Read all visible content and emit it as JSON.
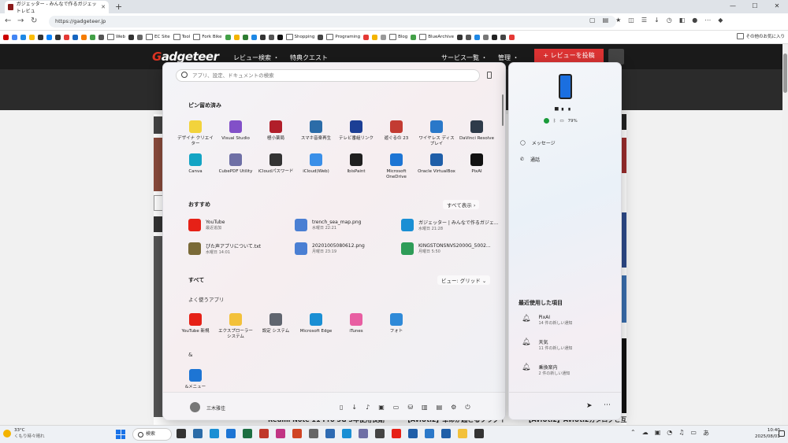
{
  "browser": {
    "tab_title": "ガジェッター - みんなで作るガジェットレビュ",
    "url": "https://gadgeteer.jp",
    "bookmarks": [
      "Web",
      "EC Site",
      "Tool",
      "Fork Bike",
      "Shopping",
      "Programing",
      "Blog",
      "BlueArchive"
    ],
    "other_bookmarks": "その他のお気に入り"
  },
  "site": {
    "logo_a": "G",
    "logo_b": "adgeteer",
    "nav": [
      "レビュー検索 ・",
      "特典クエスト",
      "サービス一覧 ・",
      "管理 ・"
    ],
    "post_button": "+ レビューを投稿",
    "headlines": [
      "Redmi Note 11 Pro 5G 3年使用長期",
      "【AviUtl2】革命が起こるプラグイ",
      "【AviUtl2】AviUtl2カタログと互"
    ]
  },
  "start_menu": {
    "search_placeholder": "アプリ、設定、ドキュメントの検索",
    "pinned_title": "ピン留め済み",
    "pinned": [
      {
        "label": "デザイナ クリエイター",
        "color": "#f2d33c"
      },
      {
        "label": "Visual Studio",
        "color": "#8250c8"
      },
      {
        "label": "極小薬局",
        "color": "#b11e2a"
      },
      {
        "label": "スマホ音楽再生",
        "color": "#2b6ca8"
      },
      {
        "label": "テレビ番組リンク",
        "color": "#1c3f95"
      },
      {
        "label": "遊ぐるの 23",
        "color": "#c33b32"
      },
      {
        "label": "ワイヤレス ディスプレイ",
        "color": "#2a78c9"
      },
      {
        "label": "DaVinci Resolve",
        "color": "#2e3b4a"
      },
      {
        "label": "Canva",
        "color": "#13a4c4"
      },
      {
        "label": "CubePDF Utility",
        "color": "#6e6fa5"
      },
      {
        "label": "iCloudパスワード",
        "color": "#333333"
      },
      {
        "label": "iCloud(Web)",
        "color": "#3a8fe8"
      },
      {
        "label": "IbisPaint",
        "color": "#1f1f1f"
      },
      {
        "label": "Microsoft OneDrive",
        "color": "#1d75d4"
      },
      {
        "label": "Oracle VirtualBox",
        "color": "#1f5ea8"
      },
      {
        "label": "PixAI",
        "color": "#111111"
      }
    ],
    "recommended_title": "おすすめ",
    "recommended_button": "すべて表示  ›",
    "recommended": [
      {
        "title": "YouTube",
        "sub": "最近追加",
        "color": "#e62117"
      },
      {
        "title": "trench_sea_map.png",
        "sub": "水曜日 22:21",
        "color": "#4a7fd3"
      },
      {
        "title": "ガジェッター | みんなで作るガジェ...",
        "sub": "水曜日 21:28",
        "color": "#1a8fd4"
      },
      {
        "title": "ぴた声アプリについて.txt",
        "sub": "水曜日 14:01",
        "color": "#7a6a38"
      },
      {
        "title": "20201005080612.png",
        "sub": "月曜日 23:19",
        "color": "#4a7fd3"
      },
      {
        "title": "KINGSTONSNVS2000G_5002...",
        "sub": "月曜日 5:50",
        "color": "#2e9c58"
      }
    ],
    "all_title": "すべて",
    "view_button": "ビュー: グリッド  ⌄",
    "frequent_title": "よく使うアプリ",
    "frequent": [
      {
        "label": "YouTube 新規",
        "color": "#e62117"
      },
      {
        "label": "エクスプローラー システム",
        "color": "#f3c13a"
      },
      {
        "label": "設定 システム",
        "color": "#60656f"
      },
      {
        "label": "Microsoft Edge",
        "color": "#1a8fd4"
      },
      {
        "label": "iTunes",
        "color": "#e85ea2"
      },
      {
        "label": "フォト",
        "color": "#2f8ad8"
      }
    ],
    "letter": "&",
    "letter_app": {
      "label": "&メニュー",
      "color": "#1d75d4"
    },
    "user_name": "三木雅佳"
  },
  "phone": {
    "device_name": "▅ ▖ ▖",
    "battery": "79%",
    "actions": [
      "メッセージ",
      "通話"
    ],
    "recent_title": "最近使用した項目",
    "notifications": [
      {
        "title": "PixAI",
        "sub": "14 件の新しい通知"
      },
      {
        "title": "天気",
        "sub": "11 件の新しい通知"
      },
      {
        "title": "乗換案内",
        "sub": "2 件の新しい通知"
      }
    ]
  },
  "taskbar": {
    "temp": "33°C",
    "weather": "くもり時々晴れ",
    "search_label": "検索",
    "time": "10:40",
    "date": "2025/08/01",
    "app_colors": [
      "#333",
      "#2b6ca8",
      "#1a8fd4",
      "#1d75d4",
      "#1d6f42",
      "#c0392b",
      "#c13584",
      "#d04423",
      "#666",
      "#2e6bb2",
      "#1a8fd4",
      "#6e6fa5",
      "#444",
      "#e62117",
      "#1f5ea8",
      "#2a78c9",
      "#1f5ea8",
      "#f3c13a",
      "#333"
    ]
  }
}
